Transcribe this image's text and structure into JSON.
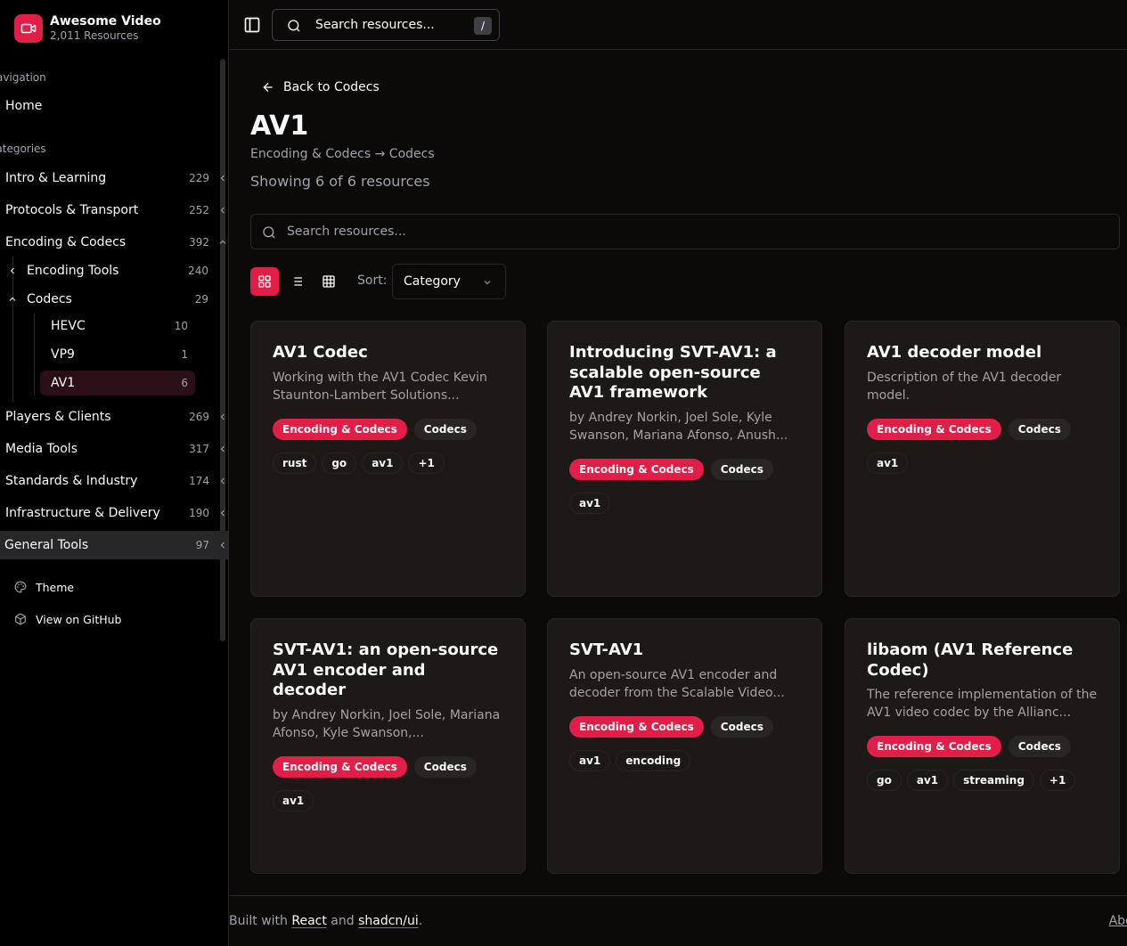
{
  "brand": {
    "title": "Awesome Video",
    "subtitle": "2,011 Resources"
  },
  "sidebar": {
    "navigation_label": "Navigation",
    "home": "Home",
    "categories_label": "Categories",
    "categories": [
      {
        "label": "Intro & Learning",
        "count": "229"
      },
      {
        "label": "Protocols & Transport",
        "count": "252"
      },
      {
        "label": "Encoding & Codecs",
        "count": "392"
      },
      {
        "label": "Players & Clients",
        "count": "269"
      },
      {
        "label": "Media Tools",
        "count": "317"
      },
      {
        "label": "Standards & Industry",
        "count": "174"
      },
      {
        "label": "Infrastructure & Delivery",
        "count": "190"
      },
      {
        "label": "General Tools",
        "count": "97"
      }
    ],
    "subcategories": [
      {
        "label": "Encoding Tools",
        "count": "240"
      },
      {
        "label": "Codecs",
        "count": "29"
      }
    ],
    "codecs": [
      {
        "label": "HEVC",
        "count": "10"
      },
      {
        "label": "VP9",
        "count": "1"
      },
      {
        "label": "AV1",
        "count": "6"
      }
    ],
    "footer": {
      "theme": "Theme",
      "github": "View on GitHub"
    }
  },
  "topbar": {
    "search_placeholder": "Search resources...",
    "shortcut": "/"
  },
  "page": {
    "back": "Back to Codecs",
    "title": "AV1",
    "breadcrumb": "Encoding & Codecs → Codecs",
    "showing": "Showing 6 of 6 resources",
    "search_placeholder": "Search resources...",
    "sort_label": "Sort:",
    "sort_value": "Category"
  },
  "cards": [
    {
      "title": "AV1 Codec",
      "desc": "Working with the AV1 Codec Kevin Staunton-Lambert Solutions...",
      "category": "Encoding & Codecs",
      "subcategory": "Codecs",
      "tags": [
        "rust",
        "go",
        "av1",
        "+1"
      ]
    },
    {
      "title": "Introducing SVT-AV1: a scalable open-source AV1 framework",
      "desc": "by Andrey Norkin, Joel Sole, Kyle Swanson, Mariana Afonso, Anush...",
      "category": "Encoding & Codecs",
      "subcategory": "Codecs",
      "tags": [
        "av1"
      ]
    },
    {
      "title": "AV1 decoder model",
      "desc": "Description of the AV1 decoder model.",
      "category": "Encoding & Codecs",
      "subcategory": "Codecs",
      "tags": [
        "av1"
      ]
    },
    {
      "title": "SVT-AV1: an open-source AV1 encoder and decoder",
      "desc": "by Andrey Norkin, Joel Sole, Mariana Afonso, Kyle Swanson,...",
      "category": "Encoding & Codecs",
      "subcategory": "Codecs",
      "tags": [
        "av1"
      ]
    },
    {
      "title": "SVT-AV1",
      "desc": "An open-source AV1 encoder and decoder from the Scalable Video...",
      "category": "Encoding & Codecs",
      "subcategory": "Codecs",
      "tags": [
        "av1",
        "encoding"
      ]
    },
    {
      "title": "libaom (AV1 Reference Codec)",
      "desc": "The reference implementation of the AV1 video codec by the Allianc...",
      "category": "Encoding & Codecs",
      "subcategory": "Codecs",
      "tags": [
        "go",
        "av1",
        "streaming",
        "+1"
      ]
    }
  ],
  "footer": {
    "built_with": "Built with",
    "react": "React",
    "and": "and",
    "shadcn": "shadcn/ui",
    "period": ".",
    "about": "About"
  },
  "colors": {
    "accent": "#e11d48",
    "background": "#0c0a09",
    "card": "#1c1917",
    "muted": "#a1a1aa"
  }
}
